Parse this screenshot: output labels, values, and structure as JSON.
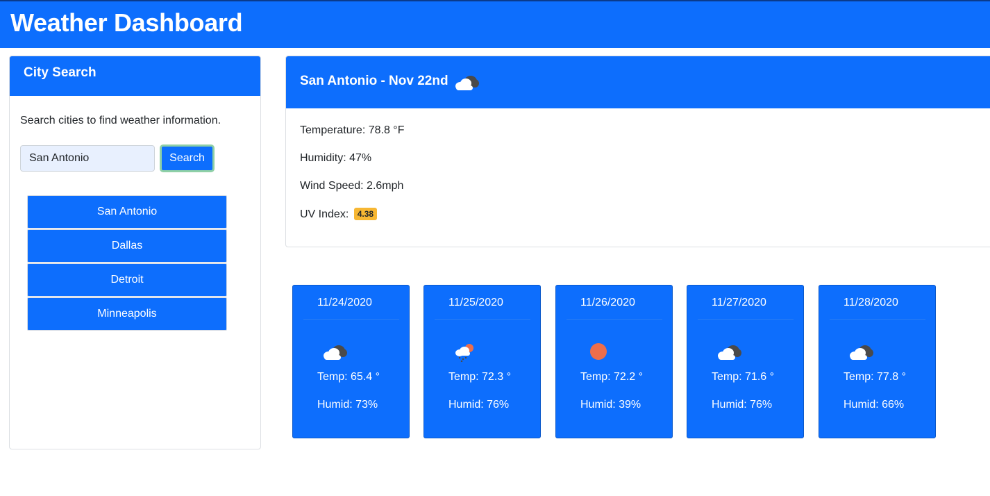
{
  "header": {
    "title": "Weather Dashboard"
  },
  "search": {
    "title": "City Search",
    "description": "Search cities to find weather information.",
    "input_value": "San Antonio",
    "button_label": "Search",
    "history": [
      "San Antonio",
      "Dallas",
      "Detroit",
      "Minneapolis"
    ]
  },
  "current": {
    "title": "San Antonio - Nov 22nd",
    "icon": "cloudy-icon",
    "temperature": "Temperature: 78.8 °F",
    "humidity": "Humidity: 47%",
    "wind": "Wind Speed: 2.6mph",
    "uv_label": "UV Index:",
    "uv_value": "4.38",
    "uv_color": "#f7b733"
  },
  "forecast": [
    {
      "date": "11/24/2020",
      "icon": "cloudy-icon",
      "temp": "Temp: 65.4 °",
      "humid": "Humid: 73%"
    },
    {
      "date": "11/25/2020",
      "icon": "rain-snow-icon",
      "temp": "Temp: 72.3 °",
      "humid": "Humid: 76%"
    },
    {
      "date": "11/26/2020",
      "icon": "sun-icon",
      "temp": "Temp: 72.2 °",
      "humid": "Humid: 39%"
    },
    {
      "date": "11/27/2020",
      "icon": "cloudy-icon",
      "temp": "Temp: 71.6 °",
      "humid": "Humid: 76%"
    },
    {
      "date": "11/28/2020",
      "icon": "cloudy-icon",
      "temp": "Temp: 77.8 °",
      "humid": "Humid: 66%"
    }
  ],
  "colors": {
    "primary": "#0d6efd",
    "sun": "#ec6e4c"
  }
}
